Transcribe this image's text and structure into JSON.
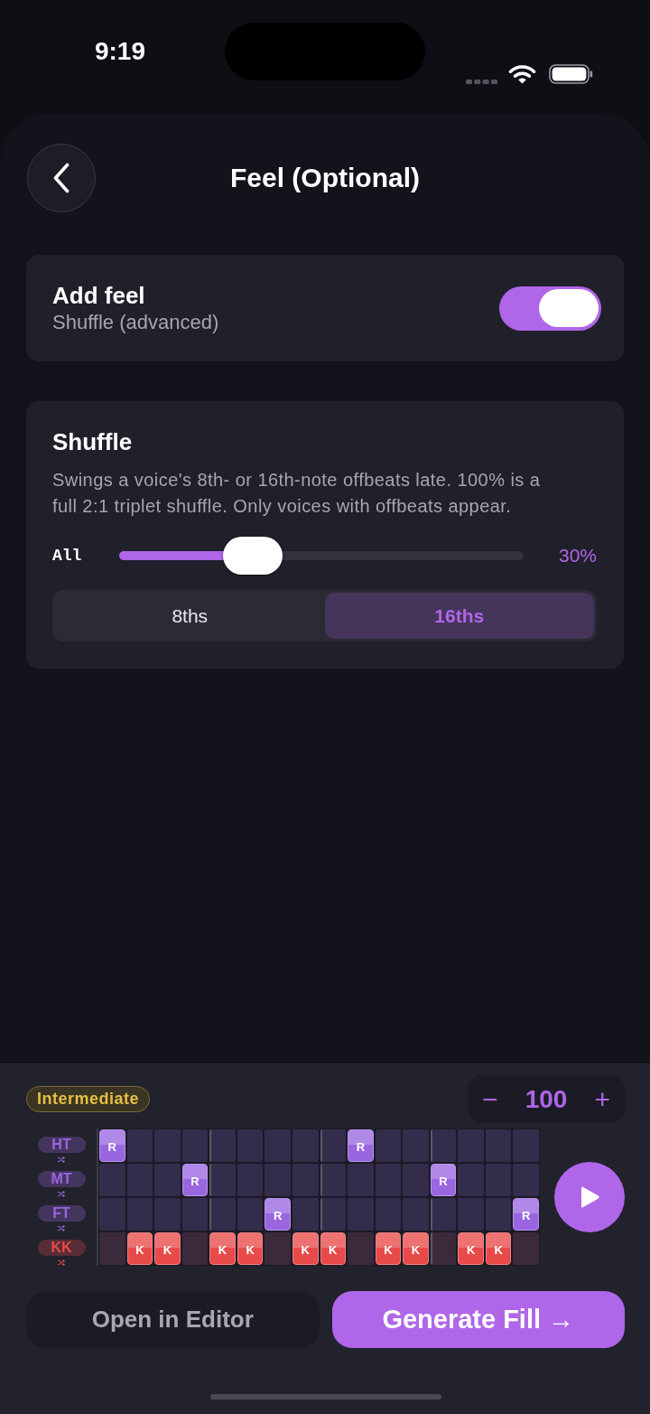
{
  "status_bar": {
    "time": "9:19"
  },
  "header": {
    "title": "Feel (Optional)"
  },
  "feel_toggle": {
    "title": "Add feel",
    "subtitle": "Shuffle (advanced)",
    "on": true
  },
  "shuffle": {
    "title": "Shuffle",
    "description": "Swings a voice's 8th- or 16th-note offbeats late. 100% is a full 2:1 triplet shuffle. Only voices with offbeats appear.",
    "slider": {
      "label": "All",
      "level": 0.3,
      "reading": "30%"
    },
    "segments": [
      {
        "label": "8ths",
        "selected": false
      },
      {
        "label": "16ths",
        "selected": true
      }
    ]
  },
  "bottom_panel": {
    "difficulty_badge": "Intermediate",
    "tempo": {
      "decrement": "−",
      "value": "100",
      "increment": "+"
    },
    "tracks": [
      {
        "label": "HT",
        "color": "#9a66e0",
        "steps": [
          {
            "on": true,
            "text": "R"
          },
          {
            "on": false
          },
          {
            "on": false
          },
          {
            "on": false
          },
          {
            "on": false
          },
          {
            "on": false
          },
          {
            "on": false
          },
          {
            "on": false
          },
          {
            "on": false
          },
          {
            "on": true,
            "text": "R"
          },
          {
            "on": false
          },
          {
            "on": false
          },
          {
            "on": false
          },
          {
            "on": false
          },
          {
            "on": false
          },
          {
            "on": false
          }
        ]
      },
      {
        "label": "MT",
        "color": "#9a66e0",
        "steps": [
          {
            "on": false
          },
          {
            "on": false
          },
          {
            "on": false
          },
          {
            "on": true,
            "text": "R"
          },
          {
            "on": false
          },
          {
            "on": false
          },
          {
            "on": false
          },
          {
            "on": false
          },
          {
            "on": false
          },
          {
            "on": false
          },
          {
            "on": false
          },
          {
            "on": false
          },
          {
            "on": true,
            "text": "R"
          },
          {
            "on": false
          },
          {
            "on": false
          },
          {
            "on": false
          }
        ]
      },
      {
        "label": "FT",
        "color": "#9a66e0",
        "steps": [
          {
            "on": false
          },
          {
            "on": false
          },
          {
            "on": false
          },
          {
            "on": false
          },
          {
            "on": false
          },
          {
            "on": false
          },
          {
            "on": true,
            "text": "R"
          },
          {
            "on": false
          },
          {
            "on": false
          },
          {
            "on": false
          },
          {
            "on": false
          },
          {
            "on": false
          },
          {
            "on": false
          },
          {
            "on": false
          },
          {
            "on": false
          },
          {
            "on": true,
            "text": "R"
          }
        ]
      },
      {
        "label": "KK",
        "color": "#e84a4a",
        "steps": [
          {
            "on": false
          },
          {
            "on": true,
            "text": "K"
          },
          {
            "on": true,
            "text": "K"
          },
          {
            "on": false
          },
          {
            "on": true,
            "text": "K"
          },
          {
            "on": true,
            "text": "K"
          },
          {
            "on": false
          },
          {
            "on": true,
            "text": "K"
          },
          {
            "on": true,
            "text": "K"
          },
          {
            "on": false
          },
          {
            "on": true,
            "text": "K"
          },
          {
            "on": true,
            "text": "K"
          },
          {
            "on": false
          },
          {
            "on": true,
            "text": "K"
          },
          {
            "on": true,
            "text": "K"
          },
          {
            "on": false
          }
        ]
      }
    ],
    "buttons": [
      {
        "label": "Open in Editor",
        "kind": "secondary"
      },
      {
        "label": "Generate Fill →",
        "kind": "primary"
      }
    ]
  }
}
